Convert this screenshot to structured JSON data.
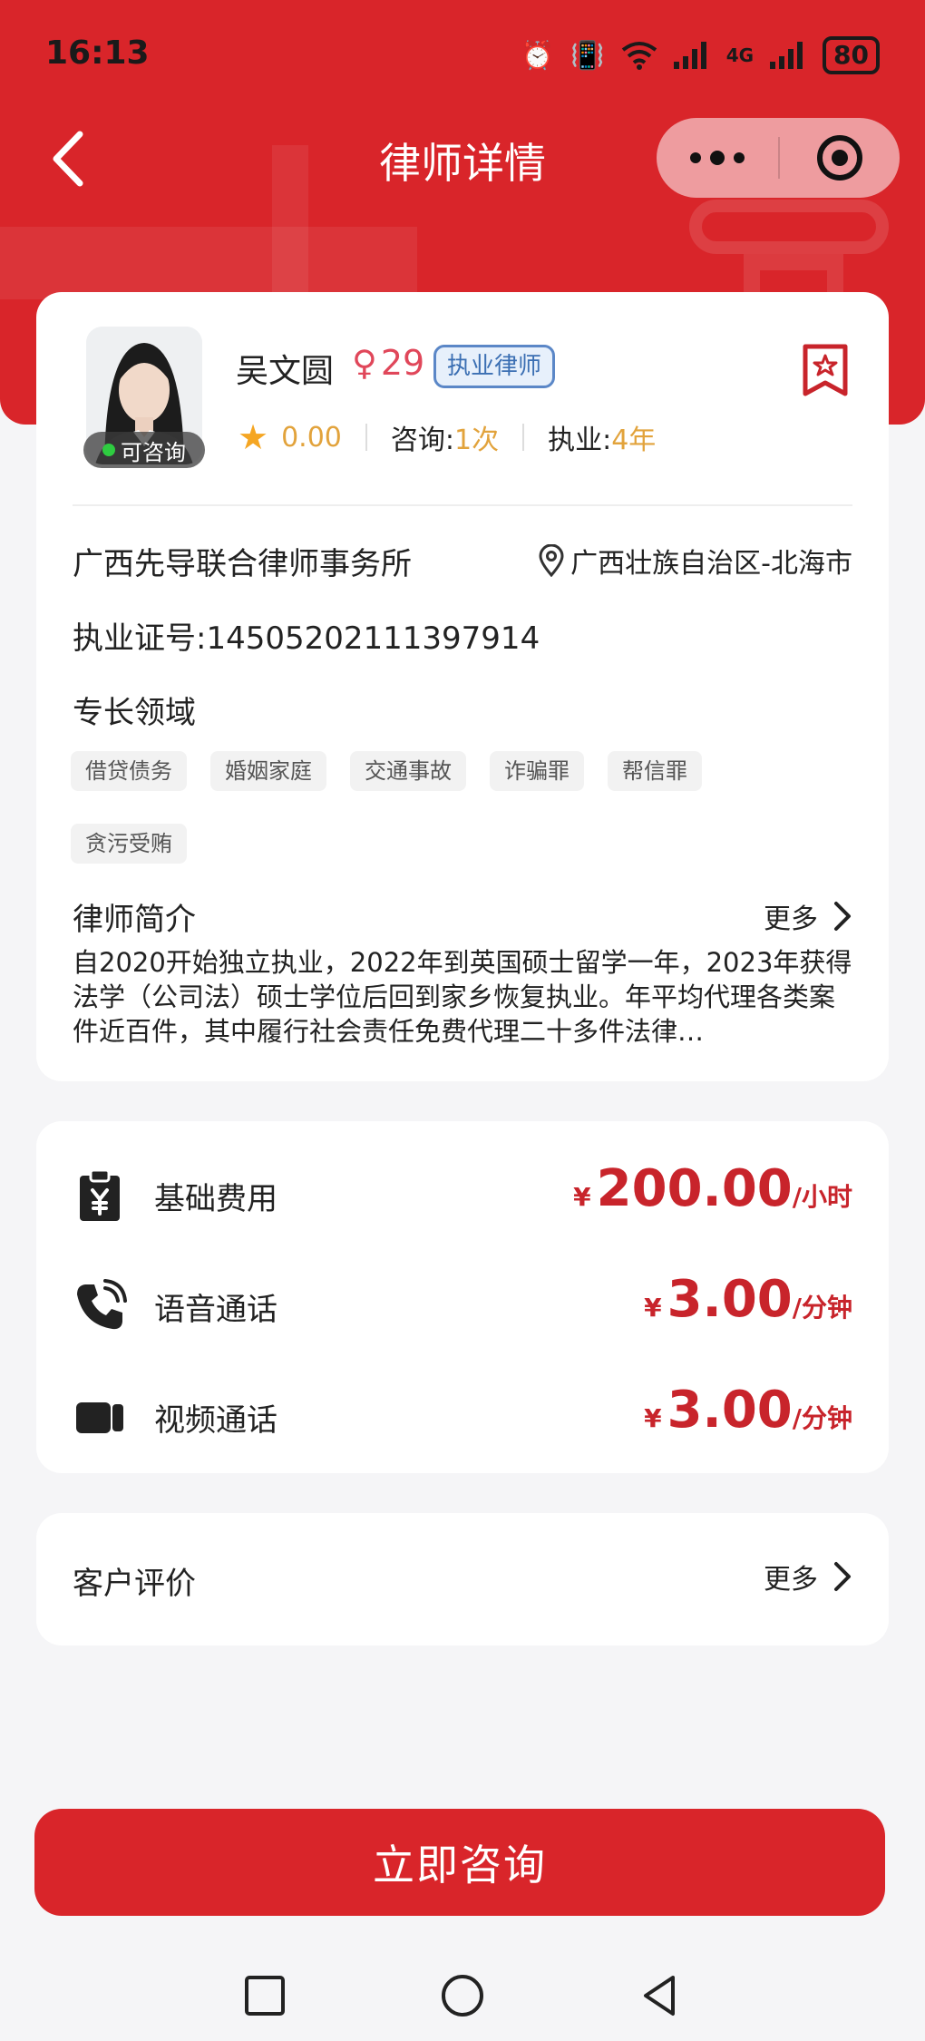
{
  "status_bar": {
    "time": "16:13",
    "network": "4G",
    "battery": "80"
  },
  "nav": {
    "title": "律师详情"
  },
  "lawyer": {
    "name": "吴文圆",
    "gender_symbol": "♀",
    "age": "29",
    "badge": "执业律师",
    "availability": "可咨询",
    "rating": "0.00",
    "consult_label": "咨询:",
    "consult_count": "1次",
    "practice_label": "执业:",
    "practice_years": "4年",
    "firm": "广西先导联合律师事务所",
    "location": "广西壮族自治区-北海市",
    "license": "执业证号:14505202111397914",
    "specialty_title": "专长领域",
    "specialties": [
      "借贷债务",
      "婚姻家庭",
      "交通事故",
      "诈骗罪",
      "帮信罪",
      "贪污受贿"
    ],
    "bio_title": "律师简介",
    "bio_more": "更多",
    "bio": "自2020开始独立执业，2022年到英国硕士留学一年，2023年获得法学（公司法）硕士学位后回到家乡恢复执业。年平均代理各类案件近百件，其中履行社会责任免费代理二十多件法律…"
  },
  "fees": [
    {
      "icon": "clipboard-yen-icon",
      "label": "基础费用",
      "currency": "¥",
      "amount": "200.00",
      "unit": "/小时"
    },
    {
      "icon": "phone-call-icon",
      "label": "语音通话",
      "currency": "¥",
      "amount": "3.00",
      "unit": "/分钟"
    },
    {
      "icon": "video-camera-icon",
      "label": "视频通话",
      "currency": "¥",
      "amount": "3.00",
      "unit": "/分钟"
    }
  ],
  "reviews": {
    "title": "客户评价",
    "more": "更多"
  },
  "cta": {
    "label": "立即咨询"
  },
  "colors": {
    "brand_red": "#d9252a",
    "price_red": "#c8242b",
    "gold": "#e2a33c",
    "female_pink": "#e0475a"
  }
}
